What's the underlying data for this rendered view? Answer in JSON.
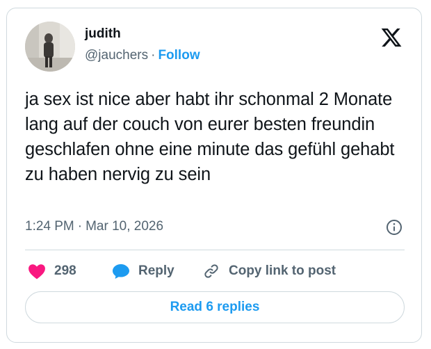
{
  "author": {
    "name": "judith",
    "handle": "@jauchers",
    "separator": "·",
    "follow_label": "Follow"
  },
  "tweet": {
    "text": "ja sex ist nice aber habt ihr schonmal 2 Monate lang auf der couch von eurer besten freundin geschlafen ohne eine minute das gefühl gehabt zu haben nervig zu sein",
    "time": "1:24 PM",
    "date": "Mar 10, 2026"
  },
  "actions": {
    "like_count": "298",
    "reply_label": "Reply",
    "copy_label": "Copy link to post"
  },
  "read_replies_label": "Read 6 replies",
  "icons": {
    "logo": "x-logo-icon",
    "info": "info-icon",
    "like": "heart-icon",
    "reply": "speech-bubble-icon",
    "copy": "link-icon"
  },
  "colors": {
    "accent": "#1d9bf0",
    "like": "#f91880",
    "text": "#0f1419",
    "secondary": "#536471",
    "border": "#cfd9de"
  }
}
